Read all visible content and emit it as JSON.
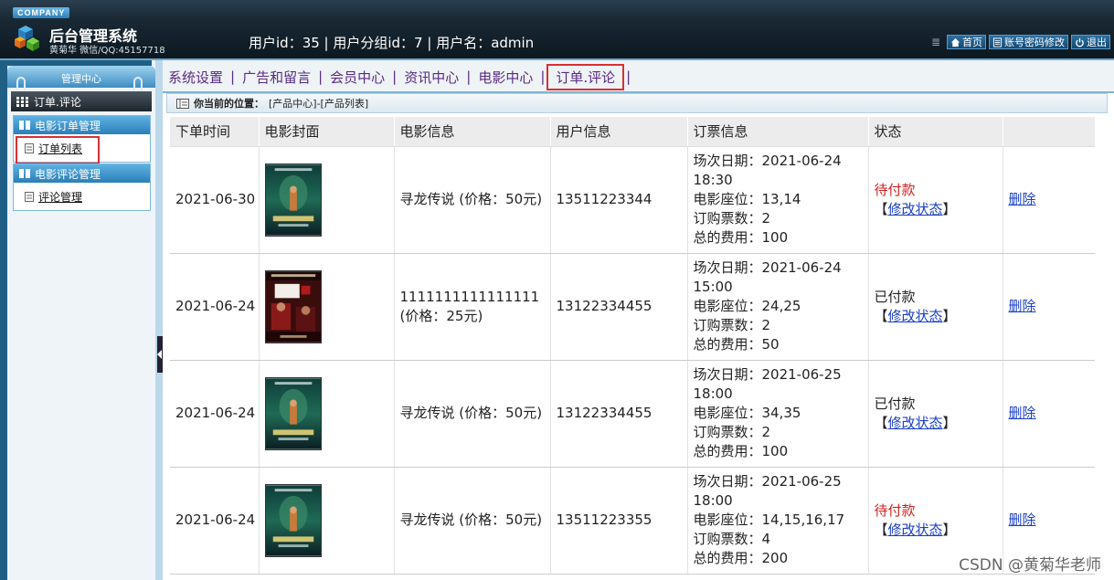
{
  "header": {
    "company": "COMPANY",
    "system_title": "后台管理系统",
    "author": "黄菊华 微信/QQ:45157718",
    "user_info": "用户id：35 | 用户分组id：7 | 用户名：admin",
    "buttons": {
      "home": "首页",
      "password": "账号密码修改",
      "logout": "退出"
    }
  },
  "sidebar": {
    "head": "管理中心",
    "current_section": "订单.评论",
    "groups": [
      {
        "title": "电影订单管理",
        "items": [
          "订单列表"
        ]
      },
      {
        "title": "电影评论管理",
        "items": [
          "评论管理"
        ]
      }
    ]
  },
  "nav": {
    "items": [
      "系统设置",
      "广告和留言",
      "会员中心",
      "资讯中心",
      "电影中心",
      "订单.评论"
    ],
    "active": "订单.评论"
  },
  "breadcrumb": {
    "label": "你当前的位置：",
    "path": "[产品中心]-[产品列表]"
  },
  "table": {
    "columns": [
      "下单时间",
      "电影封面",
      "电影信息",
      "用户信息",
      "订票信息",
      "状态",
      ""
    ],
    "rows": [
      {
        "date": "2021-06-30",
        "poster": "loong-poster",
        "movie": "寻龙传说 (价格：50元)",
        "user": "13511223344",
        "ticket": [
          "场次日期：2021-06-24 18:30",
          "电影座位：13,14",
          "订购票数：2",
          "总的费用：100"
        ],
        "status": "待付款",
        "status_type": "unpaid",
        "modify": "修改状态",
        "delete": "删除"
      },
      {
        "date": "2021-06-24",
        "poster": "saohei-poster",
        "movie": "1111111111111111 (价格：25元)",
        "user": "13122334455",
        "ticket": [
          "场次日期：2021-06-24 15:00",
          "电影座位：24,25",
          "订购票数：2",
          "总的费用：50"
        ],
        "status": "已付款",
        "status_type": "paid",
        "modify": "修改状态",
        "delete": "删除"
      },
      {
        "date": "2021-06-24",
        "poster": "loong-poster",
        "movie": "寻龙传说 (价格：50元)",
        "user": "13122334455",
        "ticket": [
          "场次日期：2021-06-25 18:00",
          "电影座位：34,35",
          "订购票数：2",
          "总的费用：100"
        ],
        "status": "已付款",
        "status_type": "paid",
        "modify": "修改状态",
        "delete": "删除"
      },
      {
        "date": "2021-06-24",
        "poster": "loong-poster",
        "movie": "寻龙传说 (价格：50元)",
        "user": "13511223355",
        "ticket": [
          "场次日期：2021-06-25 18:00",
          "电影座位：14,15,16,17",
          "订购票数：4",
          "总的费用：200"
        ],
        "status": "待付款",
        "status_type": "unpaid",
        "modify": "修改状态",
        "delete": "删除"
      }
    ]
  },
  "watermark": "CSDN @黄菊华老师",
  "colors": {
    "unpaid": "#d42020",
    "active_border": "#d93030",
    "link": "#1a3ec8"
  }
}
